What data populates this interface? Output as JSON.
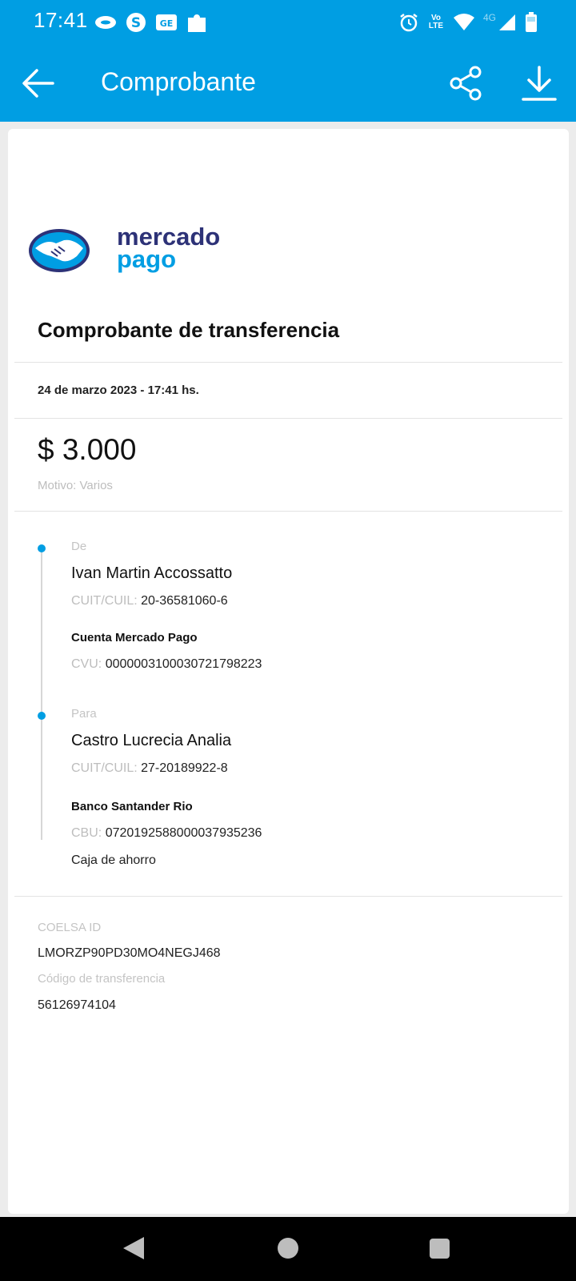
{
  "status_bar": {
    "time": "17:41",
    "network_label": "4G",
    "volte_label": "Vo LTE",
    "icons_left": [
      "chat-bubble-icon",
      "s-coin-icon",
      "ge-app-icon",
      "puzzle-icon"
    ],
    "icons_right": [
      "alarm-icon",
      "volte-icon",
      "wifi-icon",
      "signal-icon",
      "battery-icon"
    ]
  },
  "app_bar": {
    "title": "Comprobante",
    "back_icon": "arrow-left-icon",
    "share_icon": "share-icon",
    "download_icon": "download-icon"
  },
  "receipt": {
    "logo": {
      "line1": "mercado",
      "line2": "pago"
    },
    "title": "Comprobante de transferencia",
    "date": "24 de marzo 2023 - 17:41 hs.",
    "amount": "$ 3.000",
    "motivo": "Motivo: Varios",
    "from": {
      "label": "De",
      "name": "Ivan Martin Accossatto",
      "cuit_label": "CUIT/CUIL:",
      "cuit_value": "20-36581060-6",
      "account_name": "Cuenta Mercado Pago",
      "cvu_label": "CVU:",
      "cvu_value": "0000003100030721798223"
    },
    "to": {
      "label": "Para",
      "name": "Castro Lucrecia Analia",
      "cuit_label": "CUIT/CUIL:",
      "cuit_value": "27-20189922-8",
      "bank_name": "Banco Santander Rio",
      "cbu_label": "CBU:",
      "cbu_value": "0720192588000037935236",
      "account_type": "Caja de ahorro"
    },
    "coelsa": {
      "label": "COELSA ID",
      "value": "LMORZP90PD30MO4NEGJ468"
    },
    "transfer_code": {
      "label": "Código de transferencia",
      "value": "56126974104"
    }
  },
  "nav_bar": {
    "back": "triangle-back-icon",
    "home": "circle-home-icon",
    "recents": "square-recents-icon"
  },
  "colors": {
    "brand": "#009ee3",
    "logo_dark": "#2d3277"
  }
}
